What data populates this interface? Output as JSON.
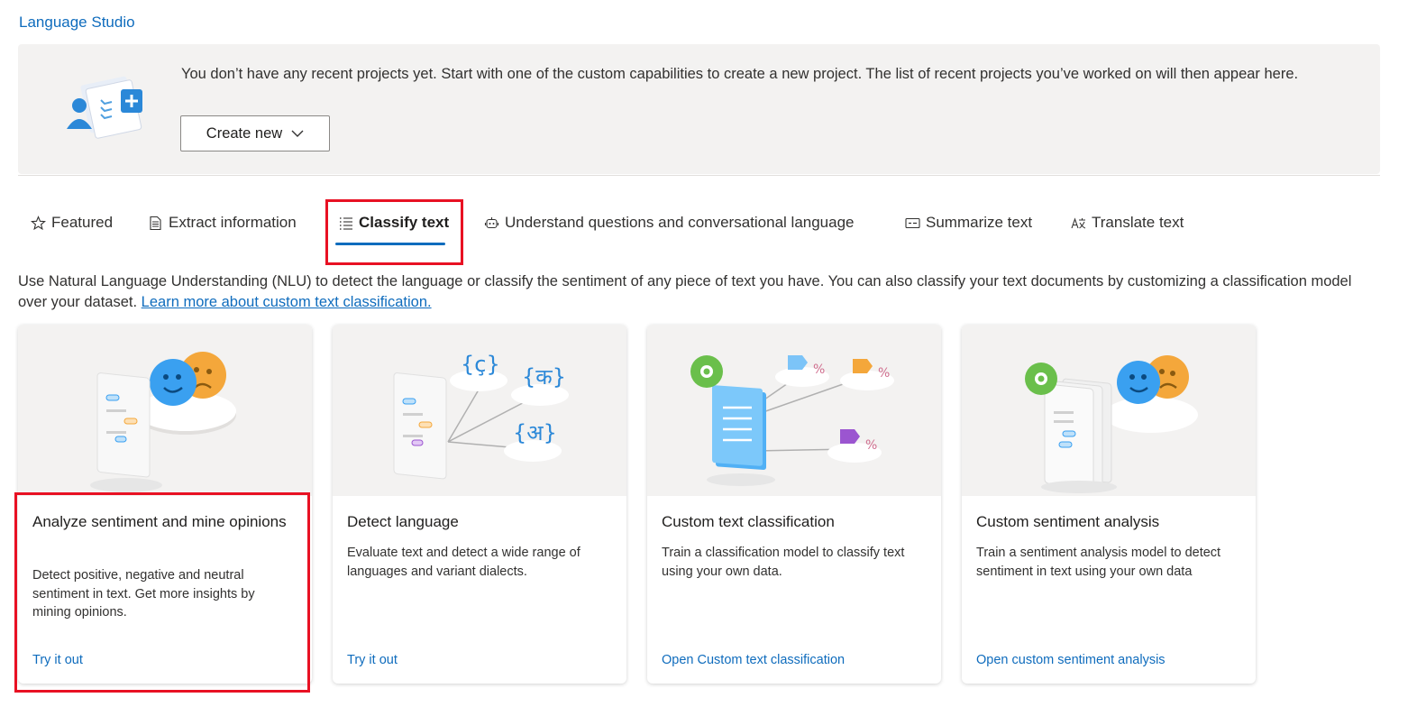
{
  "app": {
    "breadcrumb": "Language Studio"
  },
  "banner": {
    "message": "You don’t have any recent projects yet. Start with one of the custom capabilities to create a new project. The list of recent projects you’ve worked on will then appear here.",
    "create_button": "Create new"
  },
  "tabs": [
    {
      "label": "Featured",
      "icon": "star-icon"
    },
    {
      "label": "Extract information",
      "icon": "document-icon"
    },
    {
      "label": "Classify text",
      "icon": "list-icon",
      "active": true
    },
    {
      "label": "Understand questions and conversational language",
      "icon": "bot-icon"
    },
    {
      "label": "Summarize text",
      "icon": "summary-icon"
    },
    {
      "label": "Translate text",
      "icon": "translate-icon"
    }
  ],
  "description": {
    "text": "Use Natural Language Understanding (NLU) to detect the language or classify the sentiment of any piece of text you have. You can also classify your text documents by customizing a classification model over your dataset.",
    "link": "Learn more about custom text classification."
  },
  "cards": [
    {
      "title": "Analyze sentiment and mine opinions",
      "body": "Detect positive, negative and neutral sentiment in text. Get more insights by mining opinions.",
      "link": "Try it out"
    },
    {
      "title": "Detect language",
      "body": "Evaluate text and detect a wide range of languages and variant dialects.",
      "link": "Try it out"
    },
    {
      "title": "Custom text classification",
      "body": "Train a classification model to classify text using your own data.",
      "link": "Open Custom text classification"
    },
    {
      "title": "Custom sentiment analysis",
      "body": "Train a sentiment analysis model to detect sentiment in text using your own data",
      "link": "Open custom sentiment analysis"
    }
  ],
  "illustration_glyphs": {
    "lang1": "{ç}",
    "lang2": "{क}",
    "lang3": "{अ}",
    "pct": "%"
  },
  "colors": {
    "accent": "#0f6cbd",
    "highlight": "#e81123"
  }
}
